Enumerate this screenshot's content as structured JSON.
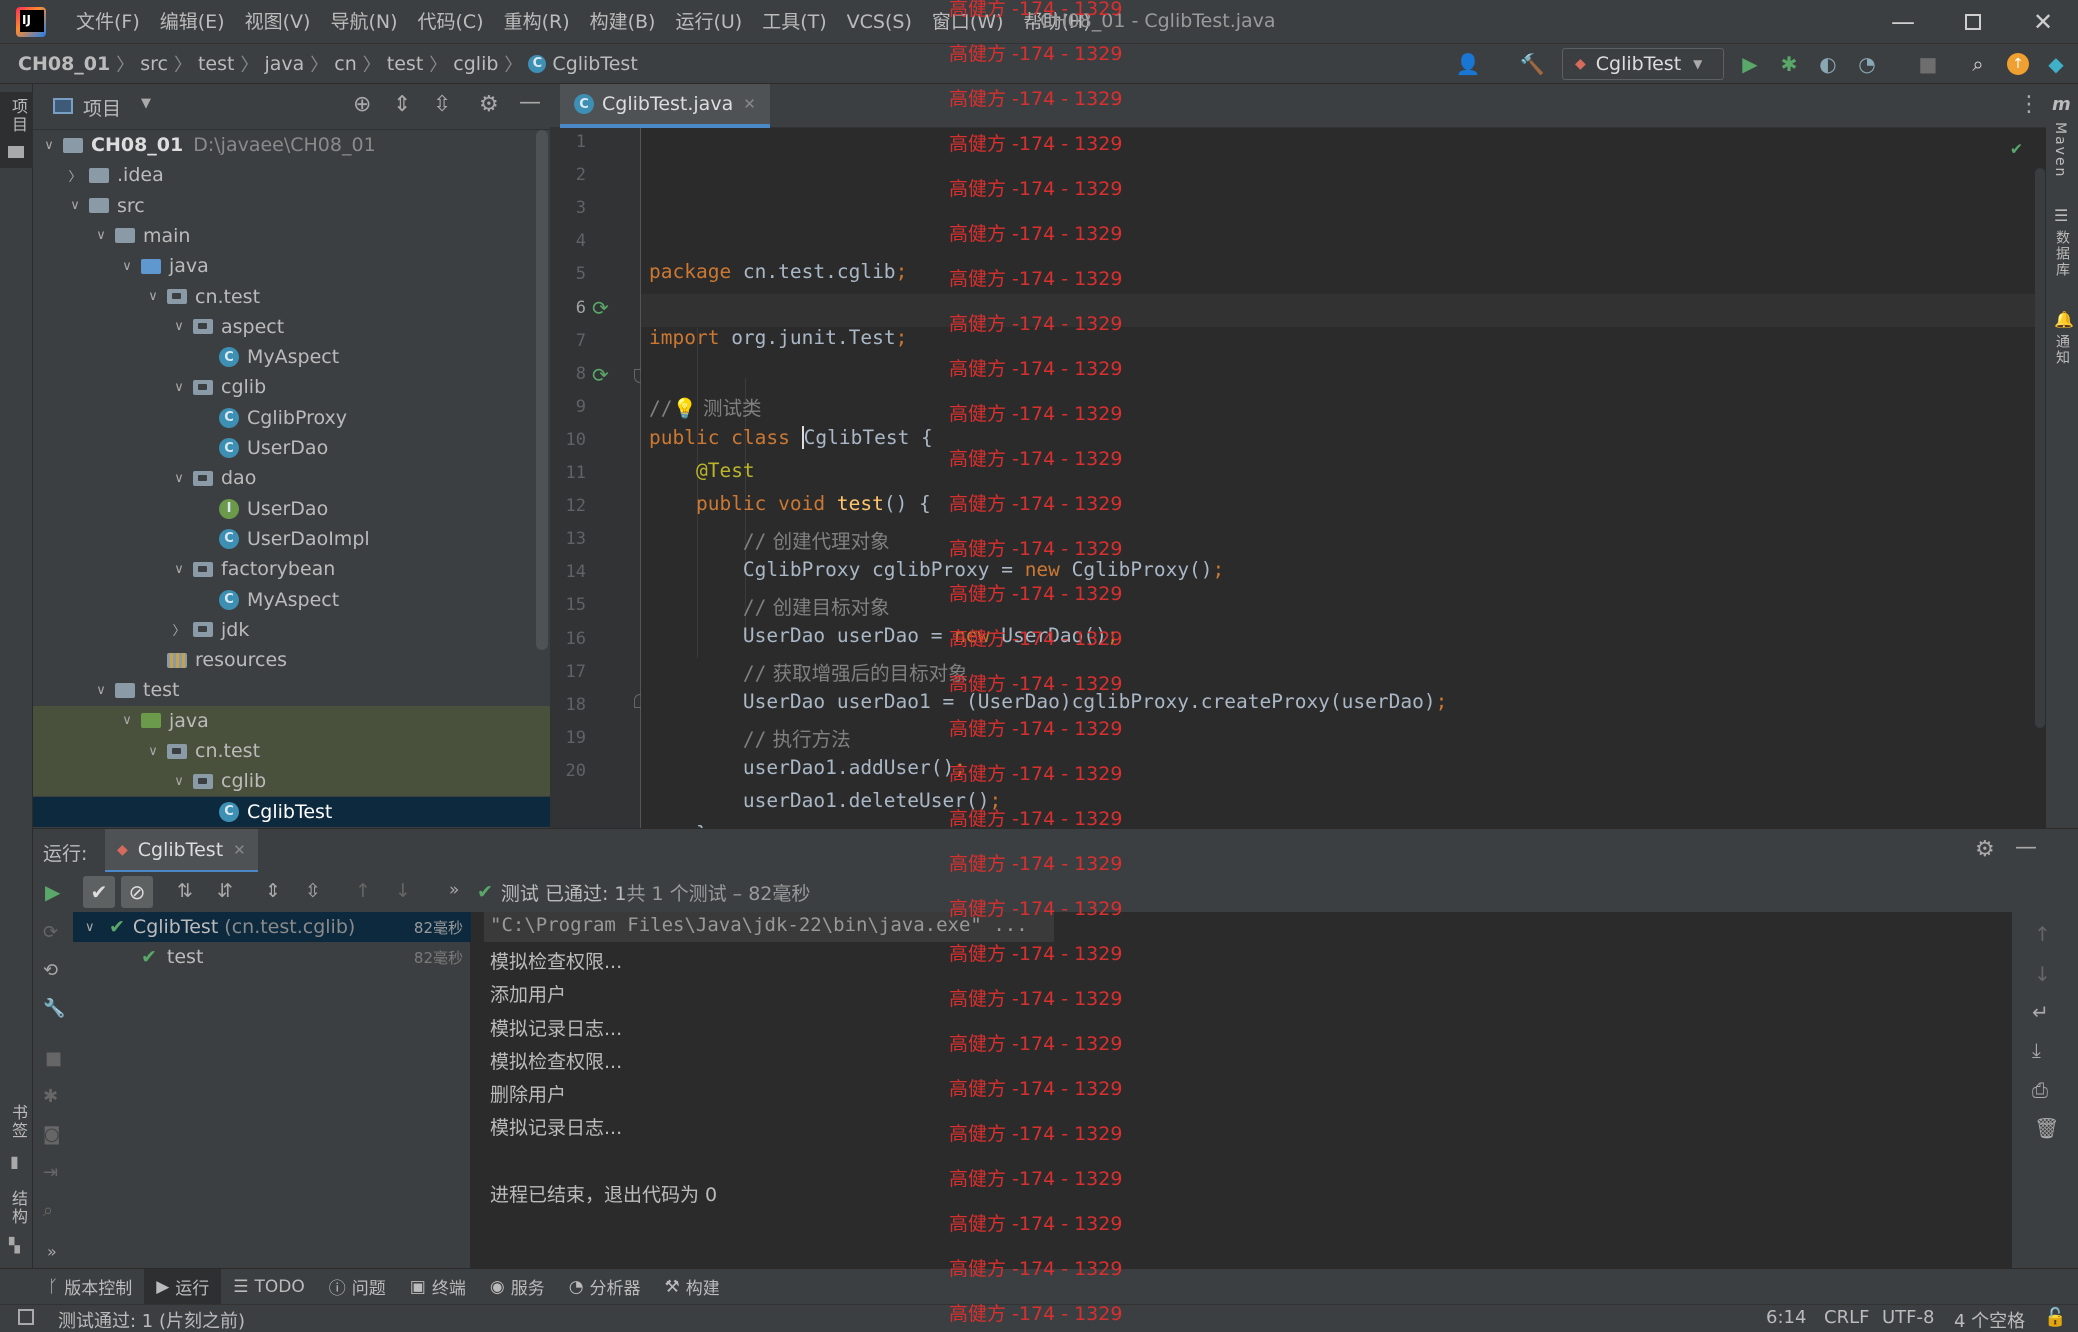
{
  "app": {
    "window_title": "CH08_01 - CglibTest.java",
    "menu": [
      "文件(F)",
      "编辑(E)",
      "视图(V)",
      "导航(N)",
      "代码(C)",
      "重构(R)",
      "构建(B)",
      "运行(U)",
      "工具(T)",
      "VCS(S)",
      "窗口(W)",
      "帮助(H)"
    ]
  },
  "breadcrumbs": [
    "CH08_01",
    "src",
    "test",
    "java",
    "cn",
    "test",
    "cglib",
    "CglibTest"
  ],
  "toolbar": {
    "run_config": "CglibTest"
  },
  "left_stripe": {
    "project": "项目",
    "bookmarks": "书签",
    "structure": "结构"
  },
  "right_stripe": {
    "maven": "Maven",
    "database": "数据库",
    "notifications": "通知"
  },
  "project_panel": {
    "title": "项目",
    "tree": [
      {
        "label": "CH08_01",
        "extra": "D:\\javaee\\CH08_01",
        "type": "module",
        "arrow": "v",
        "indent": 0
      },
      {
        "label": ".idea",
        "type": "folder",
        "arrow": ">",
        "indent": 1
      },
      {
        "label": "src",
        "type": "folder",
        "arrow": "v",
        "indent": 1
      },
      {
        "label": "main",
        "type": "folder",
        "arrow": "v",
        "indent": 2
      },
      {
        "label": "java",
        "type": "src",
        "arrow": "v",
        "indent": 3
      },
      {
        "label": "cn.test",
        "type": "pkg",
        "arrow": "v",
        "indent": 4
      },
      {
        "label": "aspect",
        "type": "pkg",
        "arrow": "v",
        "indent": 5
      },
      {
        "label": "MyAspect",
        "type": "class",
        "arrow": "",
        "indent": 6
      },
      {
        "label": "cglib",
        "type": "pkg",
        "arrow": "v",
        "indent": 5
      },
      {
        "label": "CglibProxy",
        "type": "class",
        "arrow": "",
        "indent": 6
      },
      {
        "label": "UserDao",
        "type": "class",
        "arrow": "",
        "indent": 6
      },
      {
        "label": "dao",
        "type": "pkg",
        "arrow": "v",
        "indent": 5
      },
      {
        "label": "UserDao",
        "type": "interface",
        "arrow": "",
        "indent": 6
      },
      {
        "label": "UserDaoImpl",
        "type": "class",
        "arrow": "",
        "indent": 6
      },
      {
        "label": "factorybean",
        "type": "pkg",
        "arrow": "v",
        "indent": 5
      },
      {
        "label": "MyAspect",
        "type": "class",
        "arrow": "",
        "indent": 6
      },
      {
        "label": "jdk",
        "type": "pkg",
        "arrow": ">",
        "indent": 5
      },
      {
        "label": "resources",
        "type": "res",
        "arrow": "",
        "indent": 4
      },
      {
        "label": "test",
        "type": "folder",
        "arrow": "v",
        "indent": 2
      },
      {
        "label": "java",
        "type": "test",
        "arrow": "v",
        "indent": 3,
        "hl": true
      },
      {
        "label": "cn.test",
        "type": "pkg",
        "arrow": "v",
        "indent": 4,
        "hl": true
      },
      {
        "label": "cglib",
        "type": "pkg",
        "arrow": "v",
        "indent": 5,
        "hl": true
      },
      {
        "label": "CglibTest",
        "type": "class",
        "arrow": "",
        "indent": 6,
        "sel": true
      }
    ]
  },
  "editor": {
    "tab": "CglibTest.java",
    "lines": [
      "1",
      "2",
      "3",
      "4",
      "5",
      "6",
      "7",
      "8",
      "9",
      "10",
      "11",
      "12",
      "13",
      "14",
      "15",
      "16",
      "17",
      "18",
      "19",
      "20"
    ]
  },
  "run_panel": {
    "label": "运行:",
    "tab": "CglibTest",
    "status_prefix": "测试",
    "status_passed": "已通过: 1",
    "status_detail": "共 1 个测试 – 82毫秒",
    "tests": [
      {
        "name": "CglibTest",
        "pkg": "(cn.test.cglib)",
        "time": "82毫秒"
      },
      {
        "name": "test",
        "pkg": "",
        "time": "82毫秒"
      }
    ],
    "console": [
      "\"C:\\Program Files\\Java\\jdk-22\\bin\\java.exe\" ...",
      "模拟检查权限...",
      "添加用户",
      "模拟记录日志...",
      "模拟检查权限...",
      "删除用户",
      "模拟记录日志...",
      "",
      "进程已结束，退出代码为 0"
    ]
  },
  "bottom_tabs": [
    "版本控制",
    "运行",
    "TODO",
    "问题",
    "终端",
    "服务",
    "分析器",
    "构建"
  ],
  "status": {
    "message": "测试通过: 1 (片刻之前)",
    "position": "6:14",
    "line_sep": "CRLF",
    "encoding": "UTF-8",
    "indent": "4 个空格"
  },
  "watermark": "高健方 -174 - 1329"
}
